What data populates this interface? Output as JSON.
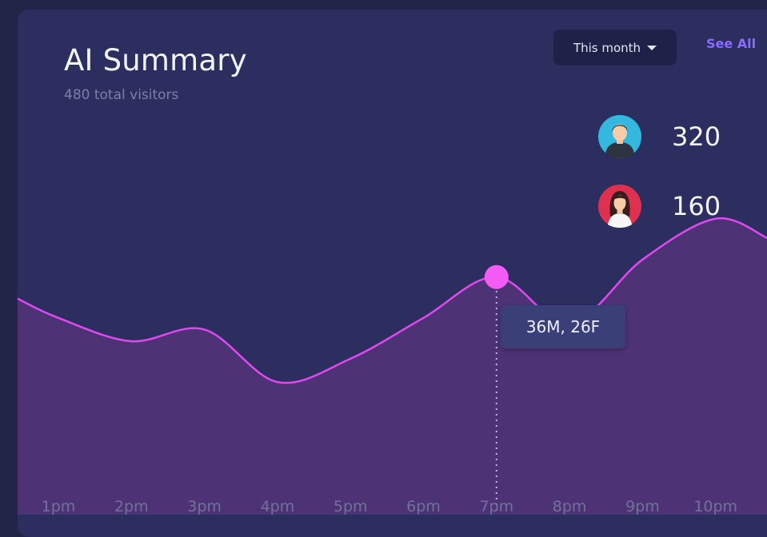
{
  "card": {
    "title": "AI Summary",
    "subtitle": "480 total visitors",
    "period_select": {
      "value": "This month",
      "icon": "caret-down-icon"
    },
    "see_all_label": "See All"
  },
  "stats": [
    {
      "icon": "male-avatar-icon",
      "count": "320",
      "color": "#35b8e0"
    },
    {
      "icon": "female-avatar-icon",
      "count": "160",
      "color": "#e0304f"
    }
  ],
  "chart_data": {
    "type": "area",
    "categories": [
      "1pm",
      "2pm",
      "3pm",
      "4pm",
      "5pm",
      "6pm",
      "7pm",
      "8pm",
      "9pm",
      "10pm"
    ],
    "values": [
      34,
      30,
      32,
      23,
      27,
      34,
      41,
      33,
      44,
      51
    ],
    "highlight_index": 6,
    "highlight_label": "36M, 26F",
    "line_color": "#e048f0",
    "fill_color": "#4d3275",
    "marker_color": "#f25cf5"
  }
}
